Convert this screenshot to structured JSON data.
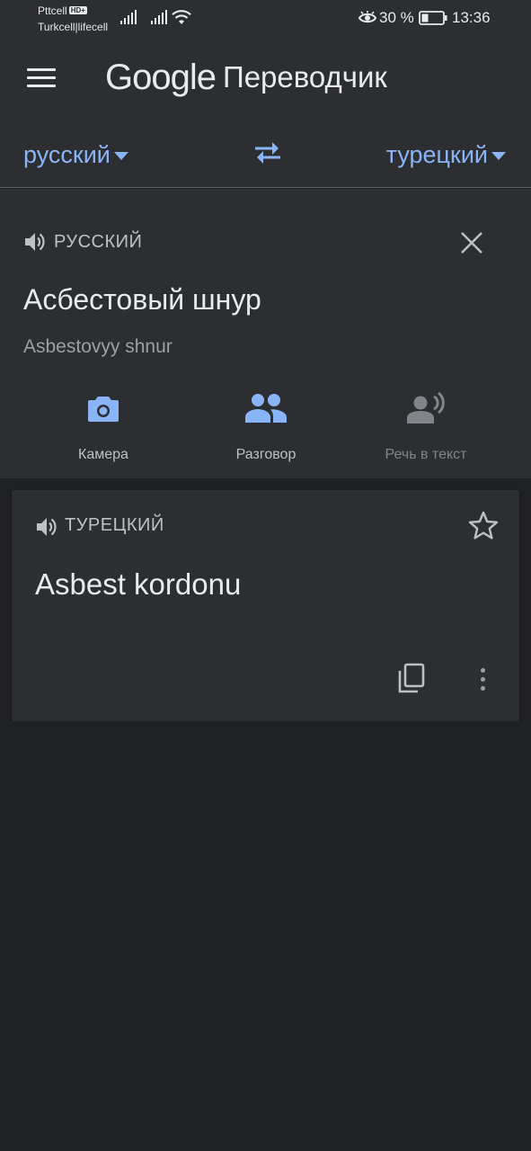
{
  "status_bar": {
    "carrier1": "Pttcell",
    "carrier1_badge": "HD+",
    "carrier2": "Turkcell|lifecell",
    "battery_percent": "30 %",
    "time": "13:36",
    "icons": [
      "signal-icon",
      "signal-icon",
      "wifi-icon",
      "eye-icon",
      "battery-icon"
    ]
  },
  "appbar": {
    "brand": "Google",
    "title": "Переводчик",
    "menu_icon": "hamburger-menu-icon"
  },
  "languages": {
    "source": "русский",
    "target": "турецкий",
    "swap_icon": "swap-arrows-icon"
  },
  "input": {
    "language_label": "РУССКИЙ",
    "text": "Асбестовый шнур",
    "transliteration": "Asbestovyy shnur",
    "tools": [
      {
        "label": "Камера",
        "icon": "camera-icon"
      },
      {
        "label": "Разговор",
        "icon": "conversation-icon"
      },
      {
        "label": "Речь в текст",
        "icon": "speech-to-text-icon"
      }
    ]
  },
  "result": {
    "language_label": "ТУРЕЦКИЙ",
    "text": "Asbest kordonu",
    "icons": [
      "speaker-icon",
      "star-icon",
      "copy-icon",
      "more-vert-icon"
    ]
  },
  "colors": {
    "accent": "#8ab4f8",
    "surface": "#2d2e31",
    "background": "#202124",
    "text_primary": "#e8eaed",
    "text_secondary": "#9aa0a6"
  }
}
